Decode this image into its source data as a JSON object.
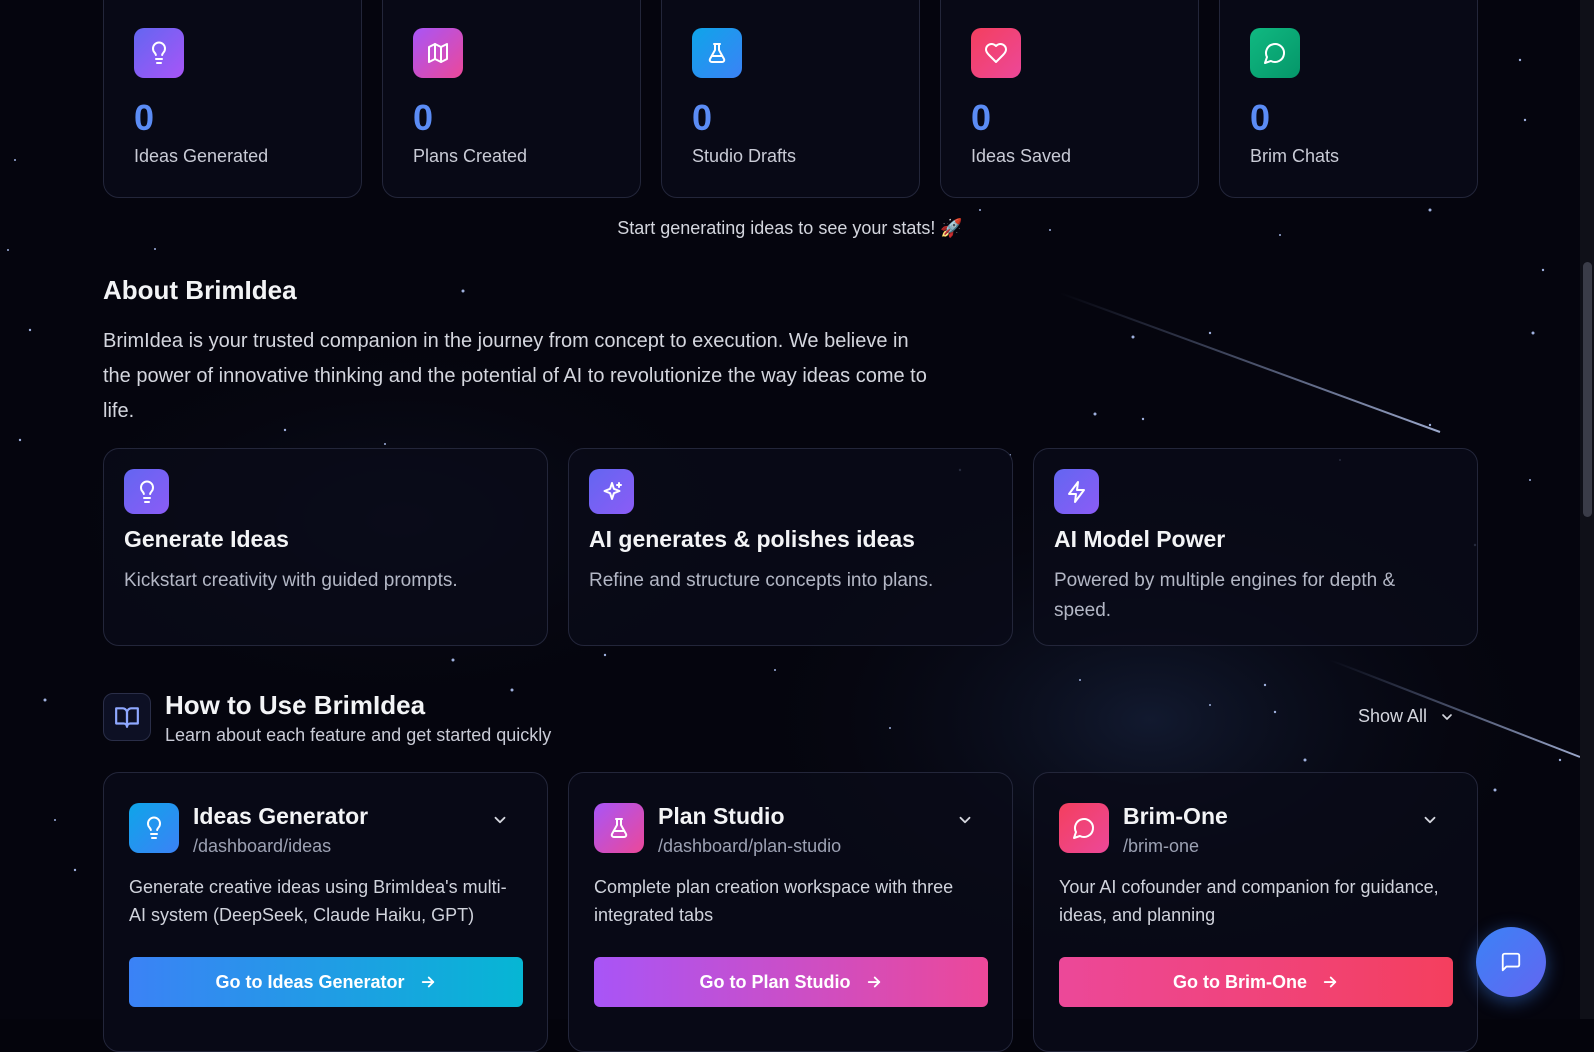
{
  "stats": [
    {
      "value": "0",
      "label": "Ideas Generated",
      "icon": "lightbulb-icon",
      "color_from": "#6366f1",
      "color_to": "#a855f7"
    },
    {
      "value": "0",
      "label": "Plans Created",
      "icon": "map-icon",
      "color_from": "#a855f7",
      "color_to": "#ec4899"
    },
    {
      "value": "0",
      "label": "Studio Drafts",
      "icon": "flask-icon",
      "color_from": "#0ea5e9",
      "color_to": "#3b82f6"
    },
    {
      "value": "0",
      "label": "Ideas Saved",
      "icon": "heart-icon",
      "color_from": "#f43f5e",
      "color_to": "#ec4899"
    },
    {
      "value": "0",
      "label": "Brim Chats",
      "icon": "chat-icon",
      "color_from": "#10b981",
      "color_to": "#059669"
    }
  ],
  "stats_hint": "Start generating ideas to see your stats! 🚀",
  "about": {
    "title": "About BrimIdea",
    "text": "BrimIdea is your trusted companion in the journey from concept to execution. We believe in the power of innovative thinking and the potential of AI to revolutionize the way ideas come to life."
  },
  "features": [
    {
      "title": "Generate Ideas",
      "desc": "Kickstart creativity with guided prompts.",
      "icon": "lightbulb-icon"
    },
    {
      "title": "AI generates & polishes ideas",
      "desc": "Refine and structure concepts into plans.",
      "icon": "sparkles-icon"
    },
    {
      "title": "AI Model Power",
      "desc": "Powered by multiple engines for depth & speed.",
      "icon": "bolt-icon"
    }
  ],
  "how_to": {
    "title": "How to Use BrimIdea",
    "subtitle": "Learn about each feature and get started quickly",
    "show_all": "Show All",
    "icon": "book-icon"
  },
  "guides": [
    {
      "title": "Ideas Generator",
      "path": "/dashboard/ideas",
      "desc": "Generate creative ideas using BrimIdea's multi-AI system (DeepSeek, Claude Haiku, GPT)",
      "button": "Go to Ideas Generator",
      "icon": "lightbulb-icon",
      "color_from": "#0ea5e9",
      "color_to": "#3b82f6",
      "btn_from": "#3b82f6",
      "btn_to": "#06b6d4"
    },
    {
      "title": "Plan Studio",
      "path": "/dashboard/plan-studio",
      "desc": "Complete plan creation workspace with three integrated tabs",
      "button": "Go to Plan Studio",
      "icon": "flask-icon",
      "color_from": "#a855f7",
      "color_to": "#ec4899",
      "btn_from": "#a855f7",
      "btn_to": "#ec4899"
    },
    {
      "title": "Brim-One",
      "path": "/brim-one",
      "desc": "Your AI cofounder and companion for guidance, ideas, and planning",
      "button": "Go to Brim-One",
      "icon": "chat-icon",
      "color_from": "#f43f5e",
      "color_to": "#ec4899",
      "btn_from": "#ec4899",
      "btn_to": "#f43f5e"
    }
  ],
  "chat_fab": {
    "icon": "chat-bubble-icon"
  }
}
